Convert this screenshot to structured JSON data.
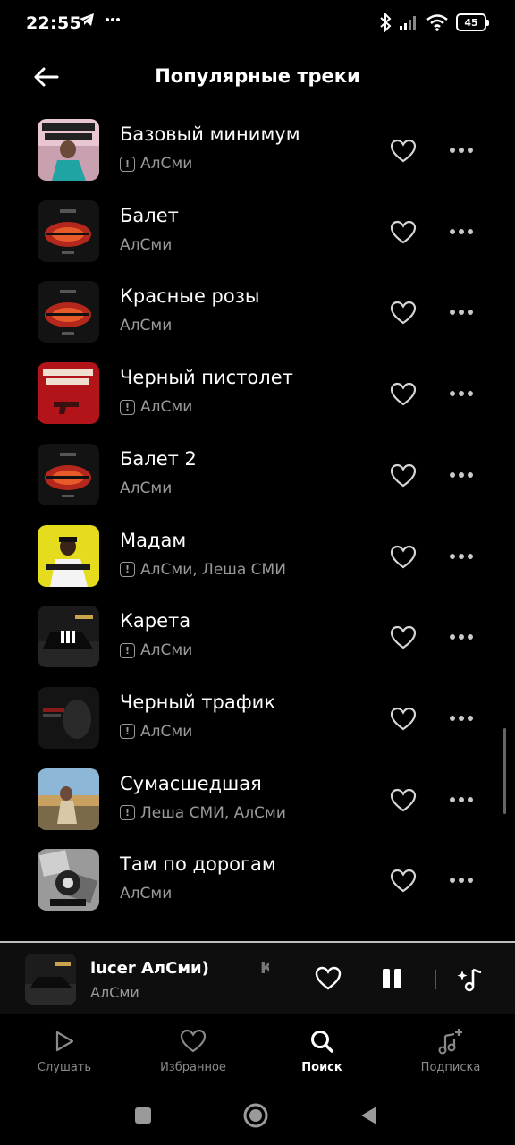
{
  "status_bar": {
    "time": "22:55",
    "battery": "45"
  },
  "header": {
    "title": "Популярные треки",
    "back_icon": "arrow-left-icon"
  },
  "tracks": [
    {
      "title": "Базовый минимум",
      "artist": "АлСми",
      "explicit": true,
      "cover": "bazoviy"
    },
    {
      "title": "Балет",
      "artist": "АлСми",
      "explicit": false,
      "cover": "red"
    },
    {
      "title": "Красные розы",
      "artist": "АлСми",
      "explicit": false,
      "cover": "red"
    },
    {
      "title": "Черный пистолет",
      "artist": "АлСми",
      "explicit": true,
      "cover": "pistol"
    },
    {
      "title": "Балет 2",
      "artist": "АлСми",
      "explicit": false,
      "cover": "red"
    },
    {
      "title": "Мадам",
      "artist": "АлСми, Леша СМИ",
      "explicit": true,
      "cover": "madam"
    },
    {
      "title": "Карета",
      "artist": "АлСми",
      "explicit": true,
      "cover": "kareta",
      "playing": true
    },
    {
      "title": "Черный трафик",
      "artist": "АлСми",
      "explicit": true,
      "cover": "trafik"
    },
    {
      "title": "Сумасшедшая",
      "artist": "Леша СМИ, АлСми",
      "explicit": true,
      "cover": "photo"
    },
    {
      "title": "Там по дорогам",
      "artist": "АлСми",
      "explicit": false,
      "cover": "dorogam"
    }
  ],
  "player": {
    "title": "lucer АлСми)",
    "next_title": "К",
    "artist": "АлСми"
  },
  "bottom_nav": [
    {
      "label": "Слушать",
      "icon": "play-icon",
      "active": false
    },
    {
      "label": "Избранное",
      "icon": "heart-icon",
      "active": false
    },
    {
      "label": "Поиск",
      "icon": "search-icon",
      "active": true
    },
    {
      "label": "Подписка",
      "icon": "music-plus-icon",
      "active": false
    }
  ],
  "colors": {
    "background": "#000000",
    "secondary_text": "#9a9a9a",
    "accent_red": "#c8231a"
  }
}
